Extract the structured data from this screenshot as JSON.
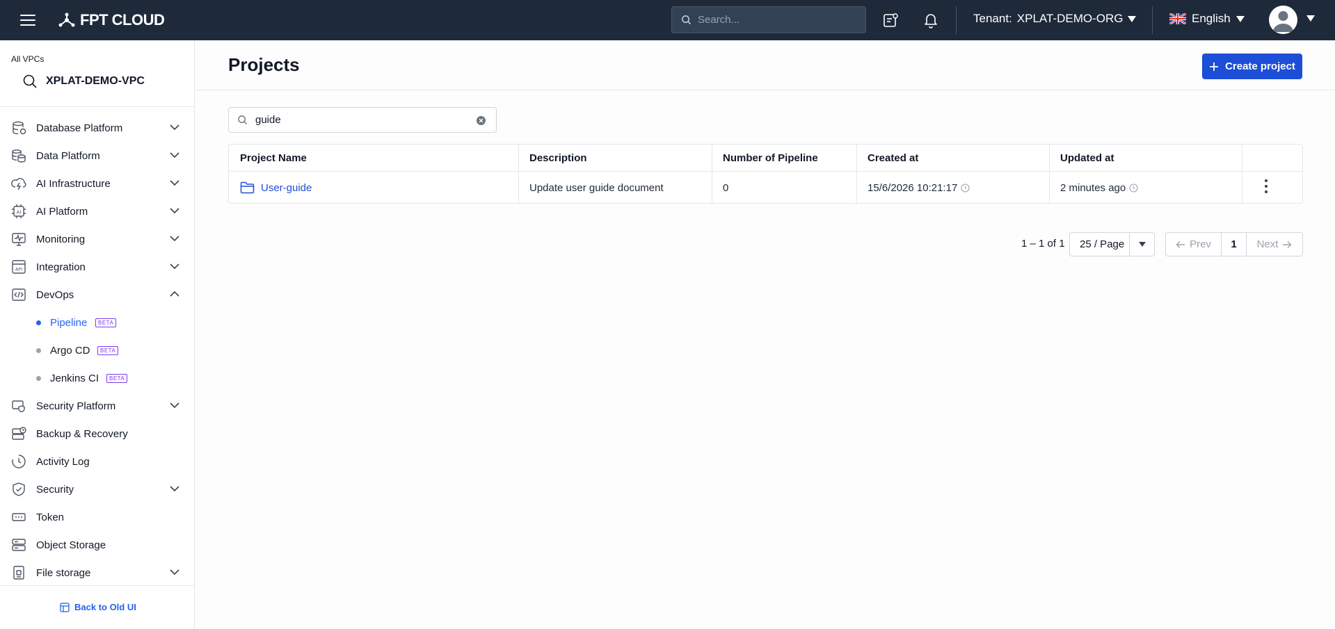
{
  "topbar": {
    "logo_text": "FPT CLOUD",
    "search_placeholder": "Search...",
    "tenant_label": "Tenant:",
    "tenant_value": "XPLAT-DEMO-ORG",
    "language": "English"
  },
  "sidebar": {
    "vpc_label": "All VPCs",
    "vpc_name": "XPLAT-DEMO-VPC",
    "items": [
      {
        "label": "Database Platform",
        "icon": "database-icon",
        "expandable": true
      },
      {
        "label": "Data Platform",
        "icon": "data-stack-icon",
        "expandable": true
      },
      {
        "label": "AI Infrastructure",
        "icon": "ai-infra-icon",
        "expandable": true
      },
      {
        "label": "AI Platform",
        "icon": "ai-chip-icon",
        "expandable": true
      },
      {
        "label": "Monitoring",
        "icon": "monitor-icon",
        "expandable": true
      },
      {
        "label": "Integration",
        "icon": "api-icon",
        "expandable": true
      },
      {
        "label": "DevOps",
        "icon": "devops-icon",
        "expandable": true,
        "expanded": true
      }
    ],
    "devops_children": [
      {
        "label": "Pipeline",
        "badge": "BETA",
        "active": true
      },
      {
        "label": "Argo CD",
        "badge": "BETA"
      },
      {
        "label": "Jenkins CI",
        "badge": "BETA"
      }
    ],
    "items_after": [
      {
        "label": "Security Platform",
        "icon": "security-platform-icon",
        "expandable": true
      },
      {
        "label": "Backup & Recovery",
        "icon": "backup-icon",
        "expandable": false
      },
      {
        "label": "Activity Log",
        "icon": "clock-icon",
        "expandable": false
      },
      {
        "label": "Security",
        "icon": "shield-icon",
        "expandable": true
      },
      {
        "label": "Token",
        "icon": "token-icon",
        "expandable": false
      },
      {
        "label": "Object Storage",
        "icon": "storage-icon",
        "expandable": false
      },
      {
        "label": "File storage",
        "icon": "file-storage-icon",
        "expandable": true
      }
    ],
    "back_to_old_ui": "Back to Old UI"
  },
  "main": {
    "title": "Projects",
    "create_button": "Create project",
    "filter_value": "guide",
    "table": {
      "columns": [
        "Project Name",
        "Description",
        "Number of Pipeline",
        "Created at",
        "Updated at"
      ],
      "rows": [
        {
          "name": "User-guide",
          "description": "Update user guide document",
          "pipelines": "0",
          "created_at": "15/6/2026 10:21:17",
          "updated_at": "2 minutes ago"
        }
      ]
    },
    "pagination": {
      "range": "1 – 1 of 1",
      "page_size": "25 / Page",
      "prev": "Prev",
      "current_page": "1",
      "next": "Next"
    }
  },
  "colors": {
    "topbar_bg": "#1e2a3a",
    "primary": "#1d4ed8",
    "beta": "#7c3aed"
  }
}
